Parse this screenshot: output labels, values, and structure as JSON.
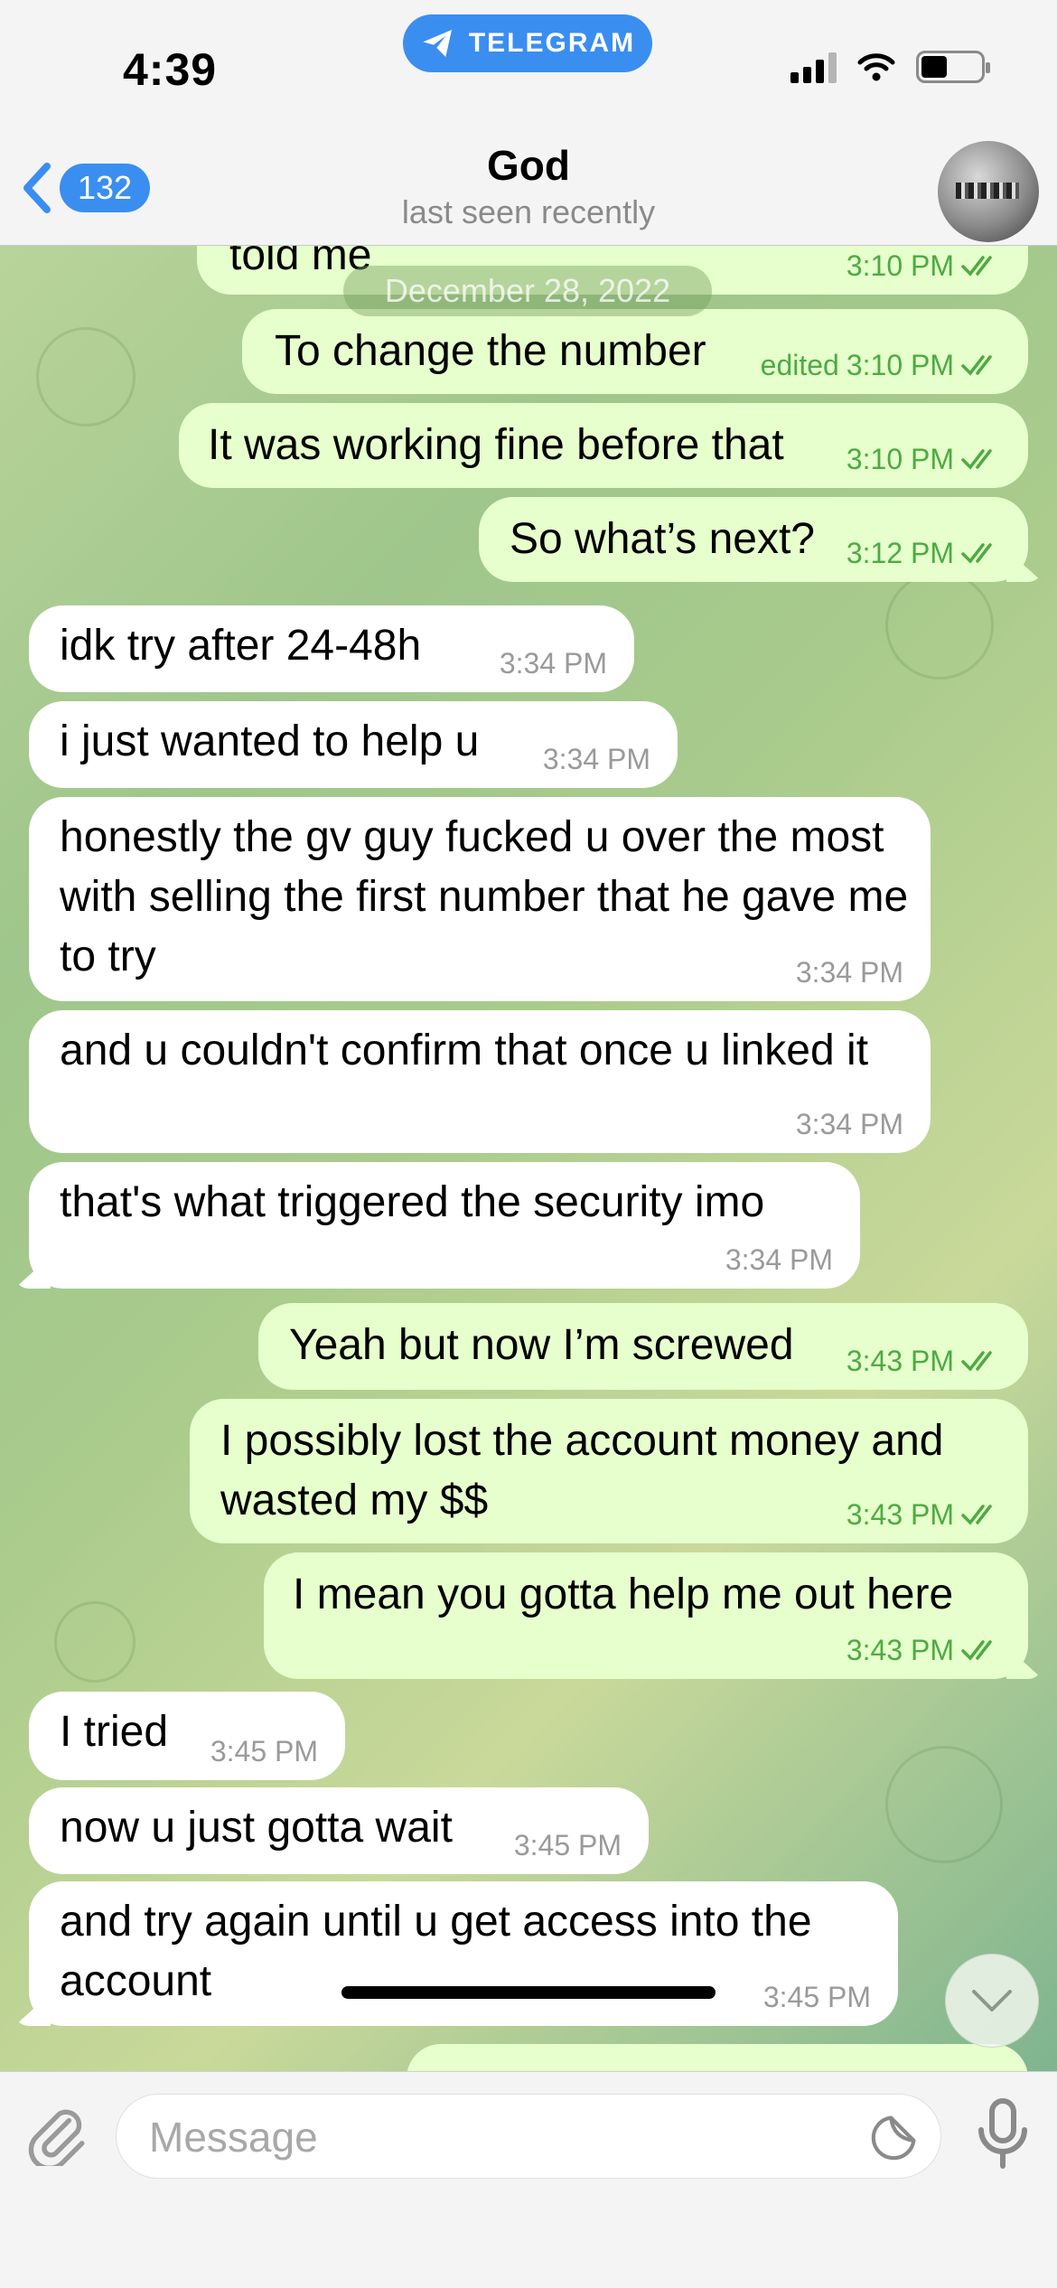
{
  "status_bar": {
    "time": "4:39",
    "app_pill": "TELEGRAM"
  },
  "header": {
    "back_count": "132",
    "title": "God",
    "subtitle": "last seen recently"
  },
  "date_pill": "December 28, 2022",
  "messages": [
    {
      "dir": "out",
      "text": "told me",
      "time": "3:10 PM",
      "edited": ""
    },
    {
      "dir": "out",
      "text": "To change the number",
      "time": "3:10 PM",
      "edited": "edited"
    },
    {
      "dir": "out",
      "text": "It was working fine before that",
      "time": "3:10 PM",
      "edited": ""
    },
    {
      "dir": "out",
      "text": "So what’s next?",
      "time": "3:12 PM",
      "edited": ""
    },
    {
      "dir": "in",
      "text": "idk try after 24-48h",
      "time": "3:34 PM"
    },
    {
      "dir": "in",
      "text": "i just wanted to help u",
      "time": "3:34 PM"
    },
    {
      "dir": "in",
      "text": "honestly the gv guy fucked u over the most with selling the first number that he gave me to try",
      "time": "3:34 PM"
    },
    {
      "dir": "in",
      "text": "and u couldn't confirm that once u linked it",
      "time": "3:34 PM"
    },
    {
      "dir": "in",
      "text": "that's what triggered the security imo",
      "time": "3:34 PM"
    },
    {
      "dir": "out",
      "text": "Yeah but now I’m screwed",
      "time": "3:43 PM"
    },
    {
      "dir": "out",
      "text": "I possibly lost the account money and wasted my $$",
      "time": "3:43 PM"
    },
    {
      "dir": "out",
      "text": "I mean you gotta help me out here",
      "time": "3:43 PM"
    },
    {
      "dir": "in",
      "text": "I tried",
      "time": "3:45 PM"
    },
    {
      "dir": "in",
      "text": "now u just gotta wait",
      "time": "3:45 PM"
    },
    {
      "dir": "in",
      "text": "and try again until u get access into the account",
      "time": "3:45 PM"
    }
  ],
  "input": {
    "placeholder": "Message",
    "value": ""
  },
  "icons": {
    "back": "chevron-left-icon",
    "attach": "paperclip-icon",
    "sticker": "sticker-icon",
    "mic": "microphone-icon",
    "scroll": "chevron-down-icon",
    "read": "double-check-icon"
  },
  "colors": {
    "accent": "#3a8ef0",
    "outgoing_bubble": "#e6ffcc",
    "incoming_bubble": "#ffffff",
    "read_check": "#4eaa44"
  }
}
